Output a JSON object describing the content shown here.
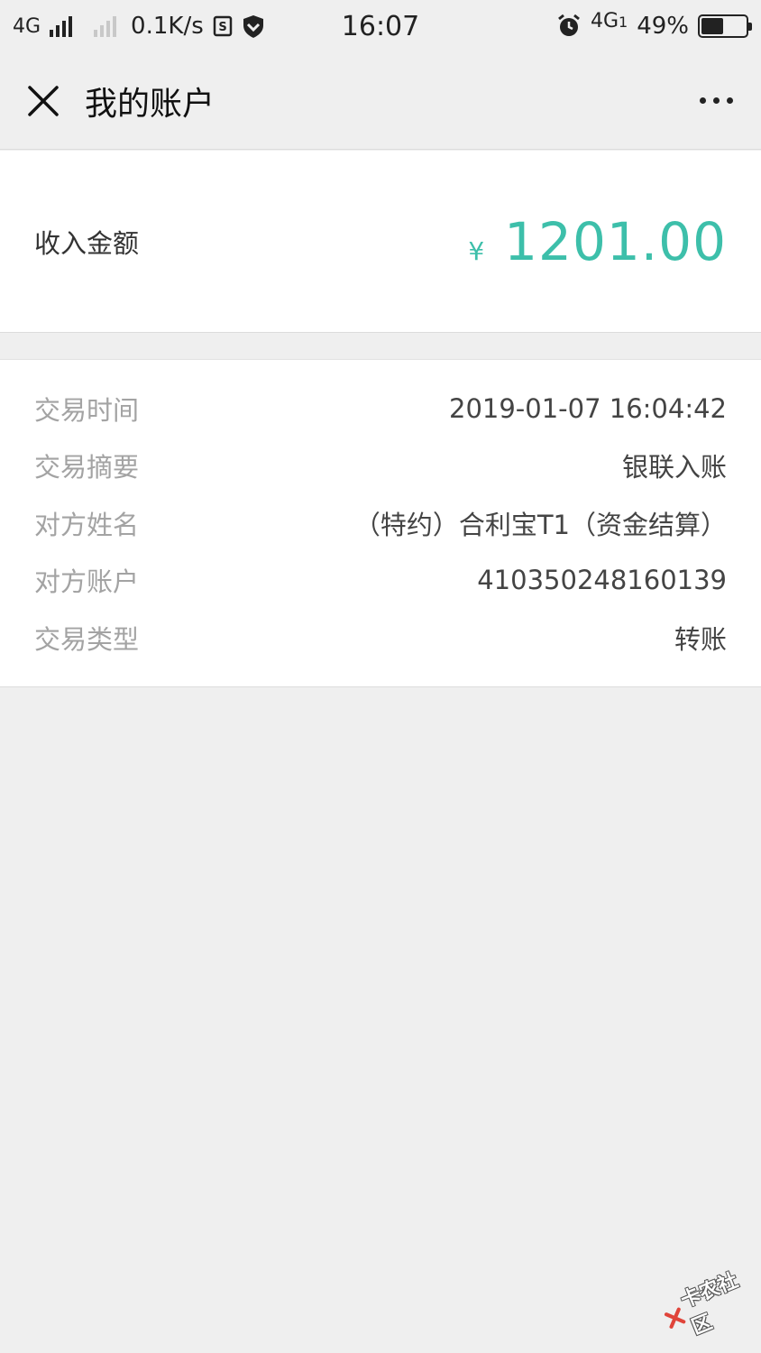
{
  "status_bar": {
    "network": "4G",
    "speed": "0.1K/s",
    "time": "16:07",
    "network2": "4G",
    "network2_suffix": "1",
    "battery": "49%",
    "battery_level": 0.49
  },
  "header": {
    "title": "我的账户"
  },
  "amount": {
    "label": "收入金额",
    "currency": "¥",
    "value": "1201.00",
    "accent_color": "#3dbfaa"
  },
  "details": [
    {
      "key": "交易时间",
      "value": "2019-01-07 16:04:42"
    },
    {
      "key": "交易摘要",
      "value": "银联入账"
    },
    {
      "key": "对方姓名",
      "value": "（特约）合利宝T1（资金结算）"
    },
    {
      "key": "对方账户",
      "value": "410350248160139"
    },
    {
      "key": "交易类型",
      "value": "转账"
    }
  ],
  "watermark": {
    "text": "卡农社区"
  }
}
